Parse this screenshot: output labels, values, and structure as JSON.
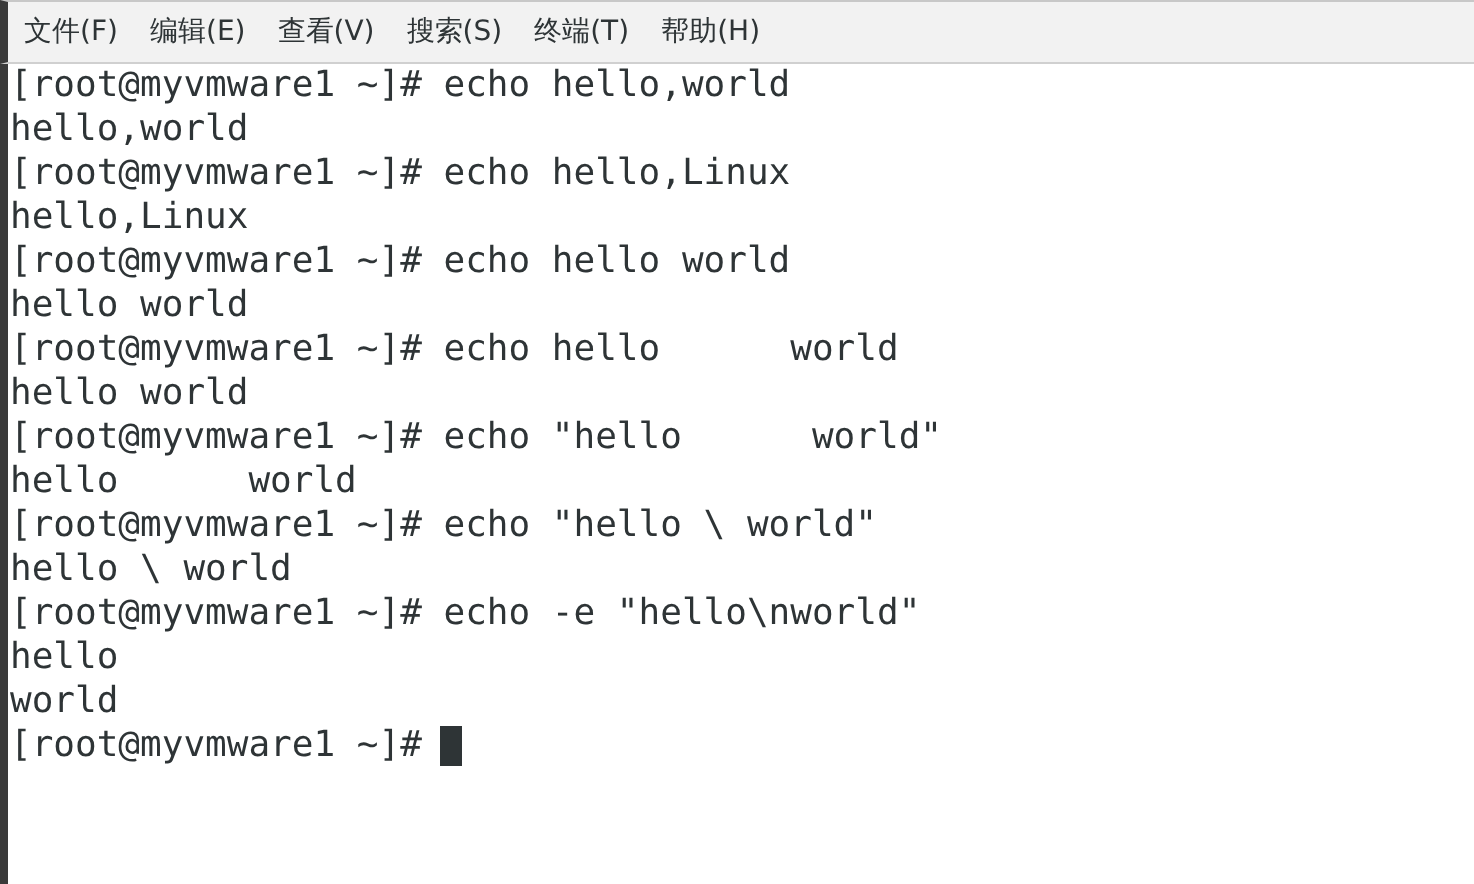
{
  "menu_bar": [
    "文件(F)",
    "编辑(E)",
    "查看(V)",
    "搜索(S)",
    "终端(T)",
    "帮助(H)"
  ],
  "terminal": {
    "lines": [
      {
        "text": "[root@myvmware1 ~]# echo hello,world",
        "cursor": false
      },
      {
        "text": "hello,world",
        "cursor": false
      },
      {
        "text": "[root@myvmware1 ~]# echo hello,Linux",
        "cursor": false
      },
      {
        "text": "hello,Linux",
        "cursor": false
      },
      {
        "text": "[root@myvmware1 ~]# echo hello world",
        "cursor": false
      },
      {
        "text": "hello world",
        "cursor": false
      },
      {
        "text": "[root@myvmware1 ~]# echo hello      world",
        "cursor": false
      },
      {
        "text": "hello world",
        "cursor": false
      },
      {
        "text": "[root@myvmware1 ~]# echo \"hello      world\"",
        "cursor": false
      },
      {
        "text": "hello      world",
        "cursor": false
      },
      {
        "text": "[root@myvmware1 ~]# echo \"hello \\ world\"",
        "cursor": false
      },
      {
        "text": "hello \\ world",
        "cursor": false
      },
      {
        "text": "[root@myvmware1 ~]# echo -e \"hello\\nworld\"",
        "cursor": false
      },
      {
        "text": "hello",
        "cursor": false
      },
      {
        "text": "world",
        "cursor": false
      },
      {
        "text": "[root@myvmware1 ~]#",
        "cursor": true
      }
    ]
  }
}
